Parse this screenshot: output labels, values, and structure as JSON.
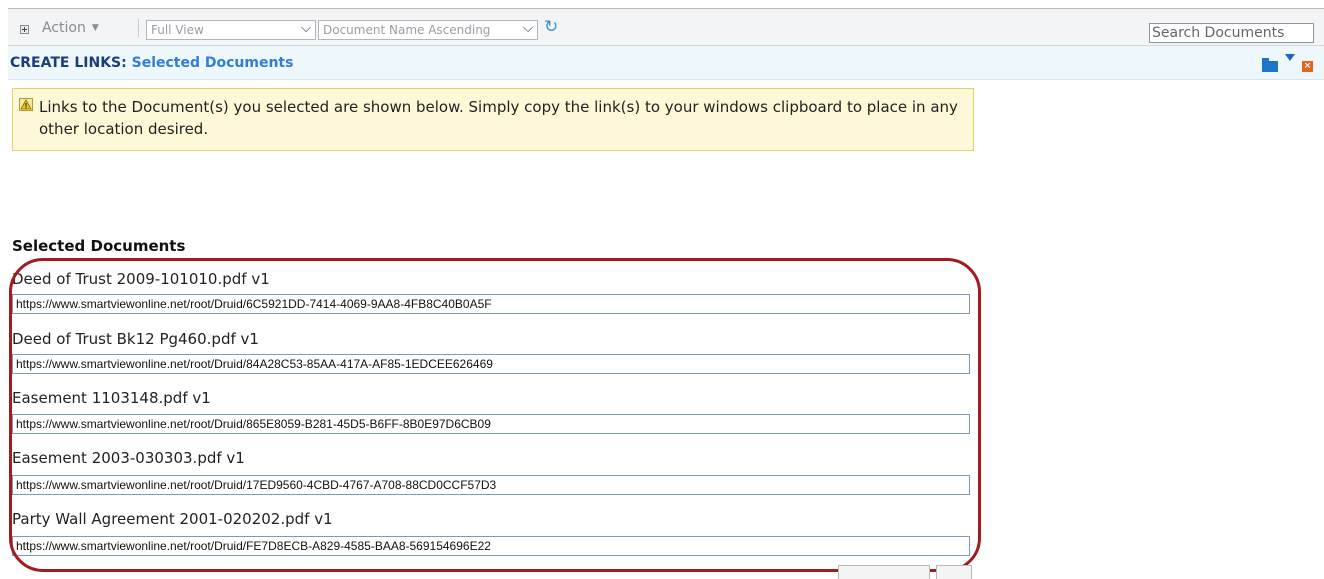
{
  "toolbar": {
    "action_label": "Action",
    "view_select": "Full View",
    "sort_select": "Document Name Ascending",
    "search_placeholder": "Search Documents"
  },
  "header": {
    "title_prefix": "CREATE LINKS:",
    "title_suffix": "Selected Documents"
  },
  "notice": {
    "text": "Links to the Document(s) you selected are shown below. Simply copy the link(s) to your windows clipboard to place in any other location desired."
  },
  "selected": {
    "heading": "Selected Documents",
    "documents": [
      {
        "name": "Deed of Trust 2009-101010.pdf v1",
        "link": "https://www.smartviewonline.net/root/Druid/6C5921DD-7414-4069-9AA8-4FB8C40B0A5F"
      },
      {
        "name": "Deed of Trust Bk12 Pg460.pdf v1",
        "link": "https://www.smartviewonline.net/root/Druid/84A28C53-85AA-417A-AF85-1EDCEE626469"
      },
      {
        "name": "Easement 1103148.pdf v1",
        "link": "https://www.smartviewonline.net/root/Druid/865E8059-B281-45D5-B6FF-8B0E97D6CB09"
      },
      {
        "name": "Easement 2003-030303.pdf v1",
        "link": "https://www.smartviewonline.net/root/Druid/17ED9560-4CBD-4767-A708-88CD0CCF57D3"
      },
      {
        "name": "Party Wall Agreement 2001-020202.pdf v1",
        "link": "https://www.smartviewonline.net/root/Druid/FE7D8ECB-A829-4585-BAA8-569154696E22"
      }
    ]
  },
  "icons": {
    "expand": "expand-icon",
    "refresh": "refresh-icon",
    "folder": "folder-icon",
    "menu_arrow": "dropdown-arrow-icon",
    "close": "close-icon",
    "warning": "warning-icon"
  },
  "colors": {
    "title_dark": "#1a3e7a",
    "title_accent": "#2f7ed8",
    "notice_bg": "#fdf8d7",
    "highlight": "#a31a1f"
  }
}
